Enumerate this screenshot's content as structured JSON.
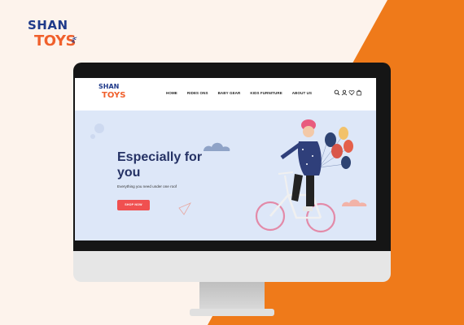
{
  "brand": {
    "logo_top": "SHAN",
    "logo_bottom": "TOYS",
    "logo_suffix": "PK"
  },
  "site": {
    "logo_top": "SHAN",
    "logo_bottom": "TOYS",
    "nav": [
      "HOME",
      "RIDES ONS",
      "BABY GEAR",
      "KIDS FURNITURE",
      "ABOUT US"
    ],
    "icons": [
      "search-icon",
      "user-icon",
      "heart-icon",
      "cart-icon"
    ]
  },
  "hero": {
    "title": "Especially for you",
    "subtitle": "Everything you need under one roof",
    "cta": "SHOP NOW"
  },
  "colors": {
    "background": "#fdf3ec",
    "accent_orange": "#ef7a1a",
    "hero_bg": "#dde7f8",
    "title_navy": "#253265",
    "cta_red": "#f05050"
  }
}
